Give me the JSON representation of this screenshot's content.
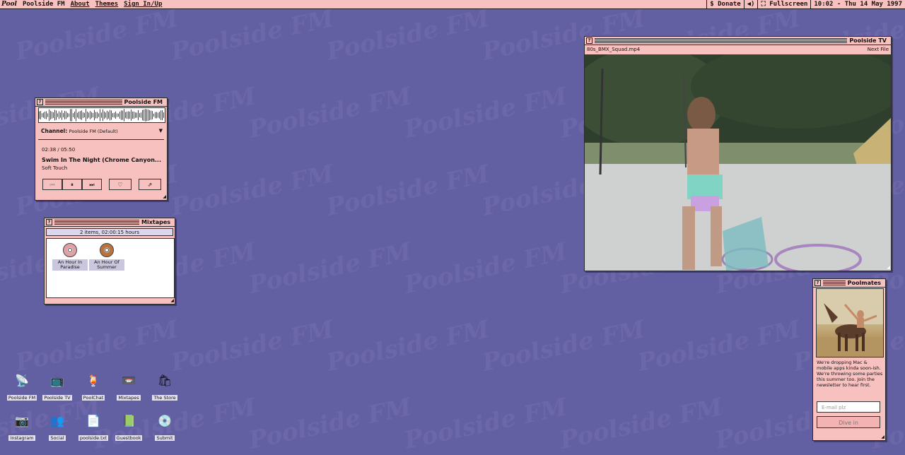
{
  "menubar": {
    "logo": "Pool",
    "app_name": "Poolside FM",
    "about": "About",
    "themes": "Themes",
    "signin": "Sign In/Up",
    "donate": "$ Donate",
    "volume_icon": "speaker-icon",
    "fullscreen": "Fullscreen",
    "clock": "10:02 - Thu 14 May 1997"
  },
  "watermark": "Poolside FM",
  "radio": {
    "title": "Poolside FM",
    "channel_label": "Channel:",
    "channel_value": "Poolside FM (Default)",
    "time": "02:38 / 05:50",
    "track": "Swim In The Night (Chrome Canyon...",
    "artist": "Soft Touch",
    "buttons": {
      "prev": "⏮",
      "pause": "⏸",
      "next": "⏭",
      "like": "♡",
      "share": "⇗"
    }
  },
  "mixtapes": {
    "title": "Mixtapes",
    "info": "2 items, 02:00:15 hours",
    "items": [
      {
        "label": "An Hour In Paradise",
        "color": "#e1a0a6"
      },
      {
        "label": "An Hour Of Summer",
        "color": "#b8733f"
      }
    ]
  },
  "tv": {
    "title": "Poolside TV",
    "filename": "80s_BMX_Squad.mp4",
    "next": "Next File"
  },
  "poolmates": {
    "title": "Poolmates",
    "text": "We're dropping Mac & mobile apps kinda soon-ish. We're throwing some parties this summer too. Join the newsletter to hear first.",
    "email_placeholder": "E-mail plz",
    "submit": "Dive in"
  },
  "desktop_icons": [
    {
      "label": "Poolside FM",
      "glyph": "📡"
    },
    {
      "label": "Poolside TV",
      "glyph": "📺"
    },
    {
      "label": "PoolChat",
      "glyph": "🍹"
    },
    {
      "label": "Mixtapes",
      "glyph": "📼"
    },
    {
      "label": "The Store",
      "glyph": "🛍"
    },
    {
      "label": "Instagram",
      "glyph": "📷"
    },
    {
      "label": "Social",
      "glyph": "👥"
    },
    {
      "label": "poolside.txt",
      "glyph": "📄"
    },
    {
      "label": "Guestbook",
      "glyph": "📗"
    },
    {
      "label": "Submit",
      "glyph": "💿"
    }
  ]
}
